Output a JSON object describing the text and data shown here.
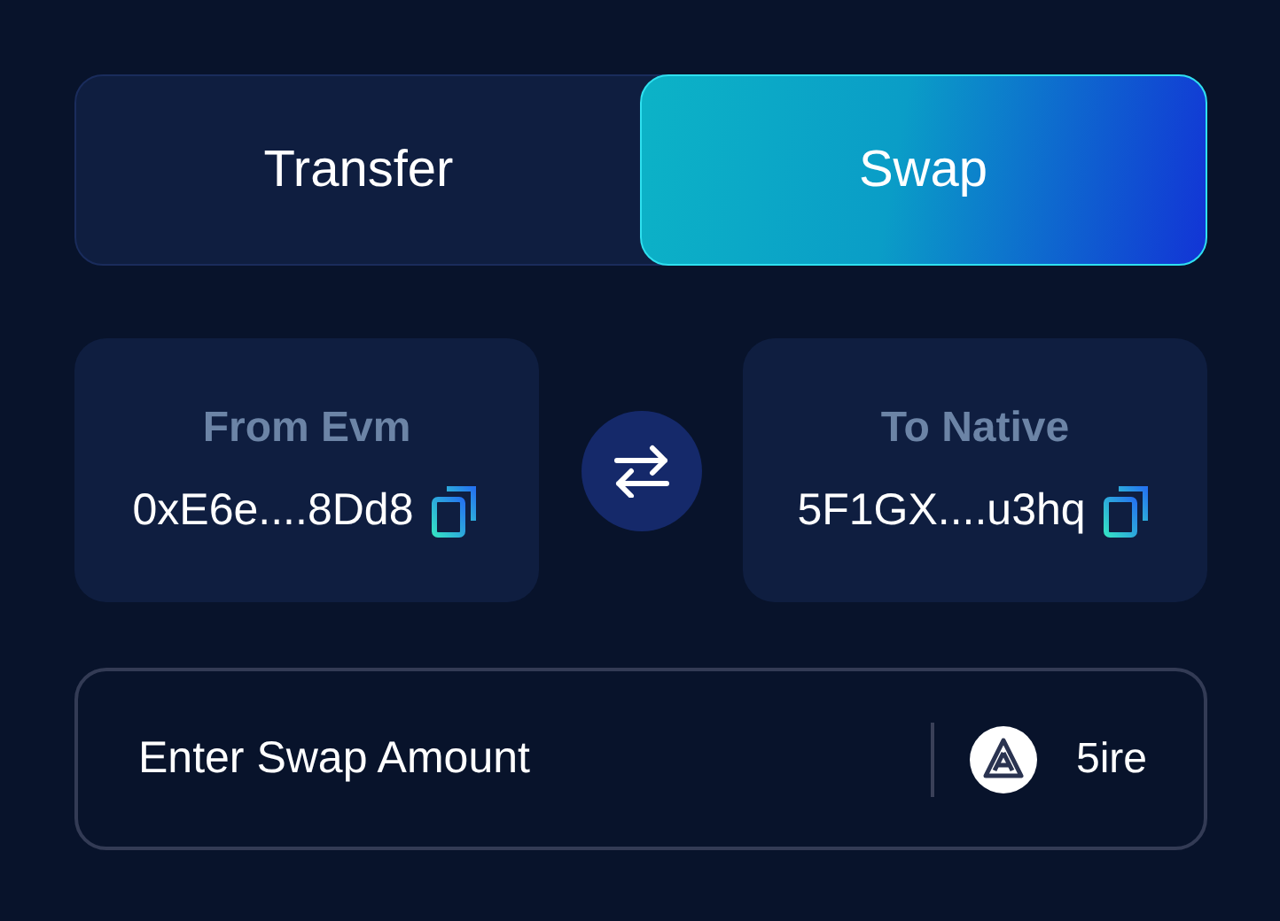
{
  "tabs": [
    {
      "label": "Transfer",
      "selected": false
    },
    {
      "label": "Swap",
      "selected": true
    }
  ],
  "from": {
    "label": "From Evm",
    "address": "0xE6e....8Dd8"
  },
  "to": {
    "label": "To Native",
    "address": "5F1GX....u3hq"
  },
  "amount": {
    "placeholder": "Enter Swap Amount",
    "token": "5ire"
  }
}
